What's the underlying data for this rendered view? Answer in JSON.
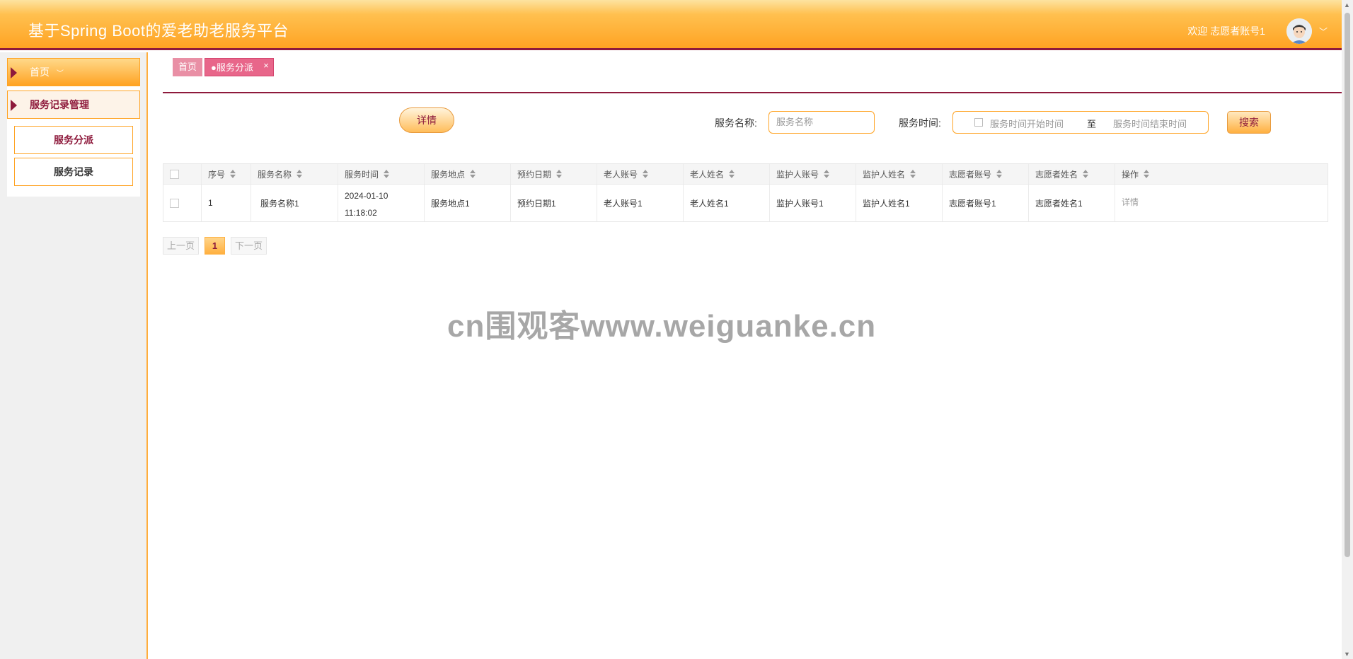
{
  "header": {
    "title": "基于Spring Boot的爱老助老服务平台",
    "welcome": "欢迎 志愿者账号1",
    "caret": "﹀"
  },
  "sidebar": {
    "home_label": "首页",
    "group_label": "服务记录管理",
    "items": [
      {
        "label": "服务分派"
      },
      {
        "label": "服务记录"
      }
    ]
  },
  "tabs": {
    "home": "首页",
    "current": "●服务分派",
    "close": "×"
  },
  "toolbar": {
    "detail_label": "详情",
    "name_label": "服务名称:",
    "name_placeholder": "服务名称",
    "time_label": "服务时间:",
    "start_placeholder": "服务时间开始时间",
    "range_sep": "至",
    "end_placeholder": "服务时间结束时间",
    "search_label": "搜索"
  },
  "table": {
    "headers": [
      "序号",
      "服务名称",
      "服务时间",
      "服务地点",
      "预约日期",
      "老人账号",
      "老人姓名",
      "监护人账号",
      "监护人姓名",
      "志愿者账号",
      "志愿者姓名",
      "操作"
    ],
    "rows": [
      {
        "cells": [
          "1",
          "服务名称1",
          "2024-01-10 11:18:02",
          "服务地点1",
          "预约日期1",
          "老人账号1",
          "老人姓名1",
          "监护人账号1",
          "监护人姓名1",
          "志愿者账号1",
          "志愿者姓名1"
        ],
        "action": "详情"
      }
    ]
  },
  "pagination": {
    "prev": "上一页",
    "current": "1",
    "next": "下一页"
  },
  "watermark": "cn围观客www.weiguanke.cn",
  "colors": {
    "brand_orange": "#ffa323",
    "brand_dark_red": "#8e1a3c",
    "tab_pink": "#e8668a"
  }
}
